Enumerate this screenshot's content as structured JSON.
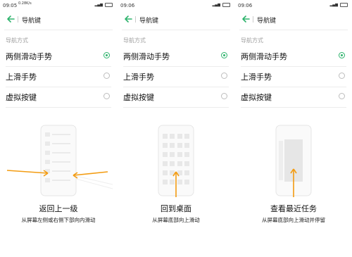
{
  "accent": "#2db36c",
  "arrow_color": "#f39c12",
  "header_title": "导航键",
  "section_label": "导航方式",
  "options": [
    "两侧滑动手势",
    "上滑手势",
    "虚拟按键"
  ],
  "icons": {
    "back": "back-arrow-icon",
    "radio_on": "radio-selected-icon",
    "radio_off": "radio-unselected-icon"
  },
  "panels": [
    {
      "time": "09:05",
      "net": "0.28K/s",
      "selected_index": 0,
      "caption": "返回上一级",
      "subcaption": "从屏幕左侧或右侧下部向内滑动"
    },
    {
      "time": "09:06",
      "net": "",
      "selected_index": 0,
      "caption": "回到桌面",
      "subcaption": "从屏幕底部向上滑动"
    },
    {
      "time": "09:06",
      "net": "",
      "selected_index": 0,
      "caption": "查看最近任务",
      "subcaption": "从屏幕底部向上滑动并停留"
    }
  ]
}
